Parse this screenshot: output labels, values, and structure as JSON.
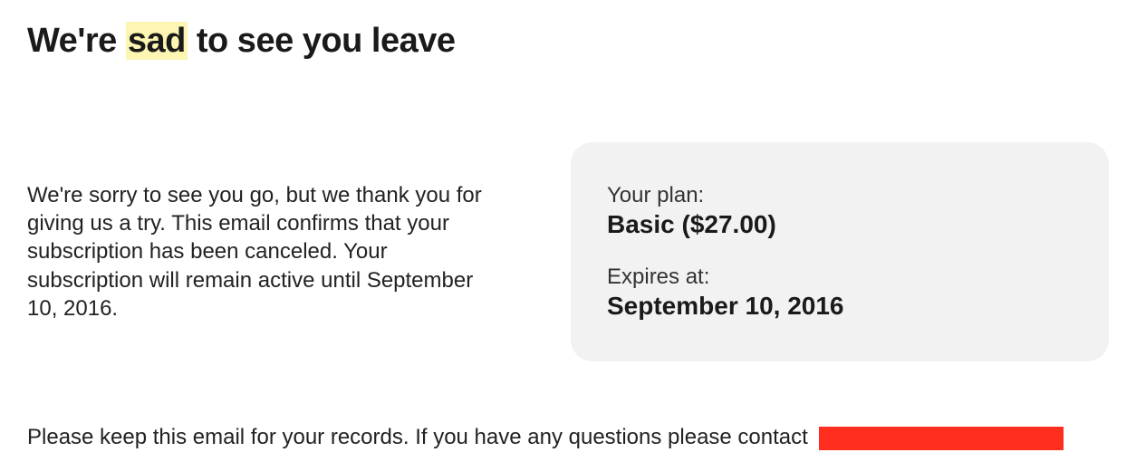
{
  "heading": {
    "part1": "We're ",
    "highlight": "sad",
    "part2": " to see you leave"
  },
  "body": "We're sorry to see you go, but we thank you for giving us a try. This email confirms that your subscription has been canceled. Your subscription will remain active until September 10, 2016.",
  "info": {
    "plan_label": "Your plan:",
    "plan_value": "Basic ($27.00)",
    "expires_label": "Expires at:",
    "expires_value": "September 10, 2016"
  },
  "footer": "Please keep this email for your records. If you have any questions please contact"
}
